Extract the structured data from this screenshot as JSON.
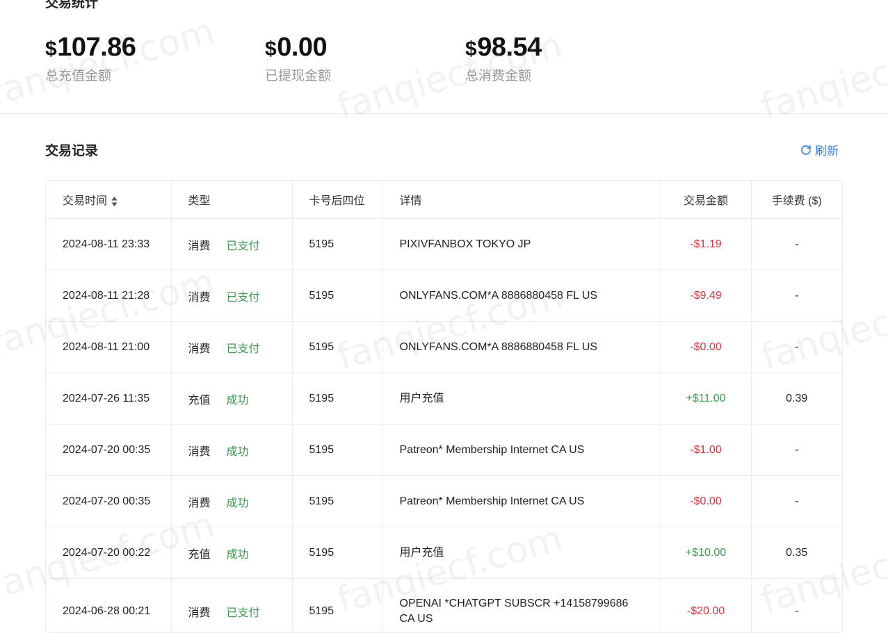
{
  "stats": {
    "title": "交易统计",
    "currency_symbol": "$",
    "items": [
      {
        "amount": "107.86",
        "label": "总充值金额"
      },
      {
        "amount": "0.00",
        "label": "已提现金额"
      },
      {
        "amount": "98.54",
        "label": "总消费金额"
      }
    ]
  },
  "records": {
    "title": "交易记录",
    "refresh_label": "刷新",
    "columns": [
      "交易时间",
      "类型",
      "卡号后四位",
      "详情",
      "交易金额",
      "手续费 ($)"
    ],
    "rows": [
      {
        "time": "2024-08-11 23:33",
        "type": "消费",
        "status": "已支付",
        "card": "5195",
        "detail": "PIXIVFANBOX TOKYO JP",
        "amount": "-$1.19",
        "fee": "-"
      },
      {
        "time": "2024-08-11 21:28",
        "type": "消费",
        "status": "已支付",
        "card": "5195",
        "detail": "ONLYFANS.COM*A 8886880458 FL US",
        "amount": "-$9.49",
        "fee": "-"
      },
      {
        "time": "2024-08-11 21:00",
        "type": "消费",
        "status": "已支付",
        "card": "5195",
        "detail": "ONLYFANS.COM*A 8886880458 FL US",
        "amount": "-$0.00",
        "fee": "-"
      },
      {
        "time": "2024-07-26 11:35",
        "type": "充值",
        "status": "成功",
        "card": "5195",
        "detail": "用户充值",
        "amount": "+$11.00",
        "fee": "0.39"
      },
      {
        "time": "2024-07-20 00:35",
        "type": "消费",
        "status": "成功",
        "card": "5195",
        "detail": "Patreon* Membership Internet CA US",
        "amount": "-$1.00",
        "fee": "-"
      },
      {
        "time": "2024-07-20 00:35",
        "type": "消费",
        "status": "成功",
        "card": "5195",
        "detail": "Patreon* Membership Internet CA US",
        "amount": "-$0.00",
        "fee": "-"
      },
      {
        "time": "2024-07-20 00:22",
        "type": "充值",
        "status": "成功",
        "card": "5195",
        "detail": "用户充值",
        "amount": "+$10.00",
        "fee": "0.35"
      },
      {
        "time": "2024-06-28 00:21",
        "type": "消费",
        "status": "已支付",
        "card": "5195",
        "detail": "OPENAI *CHATGPT SUBSCR +14158799686 CA US",
        "amount": "-$20.00",
        "fee": "-"
      }
    ]
  },
  "watermark": "fanqiecf.com",
  "colors": {
    "positive": "#3a9a4d",
    "negative": "#d9363e",
    "link": "#2f7fd6"
  }
}
